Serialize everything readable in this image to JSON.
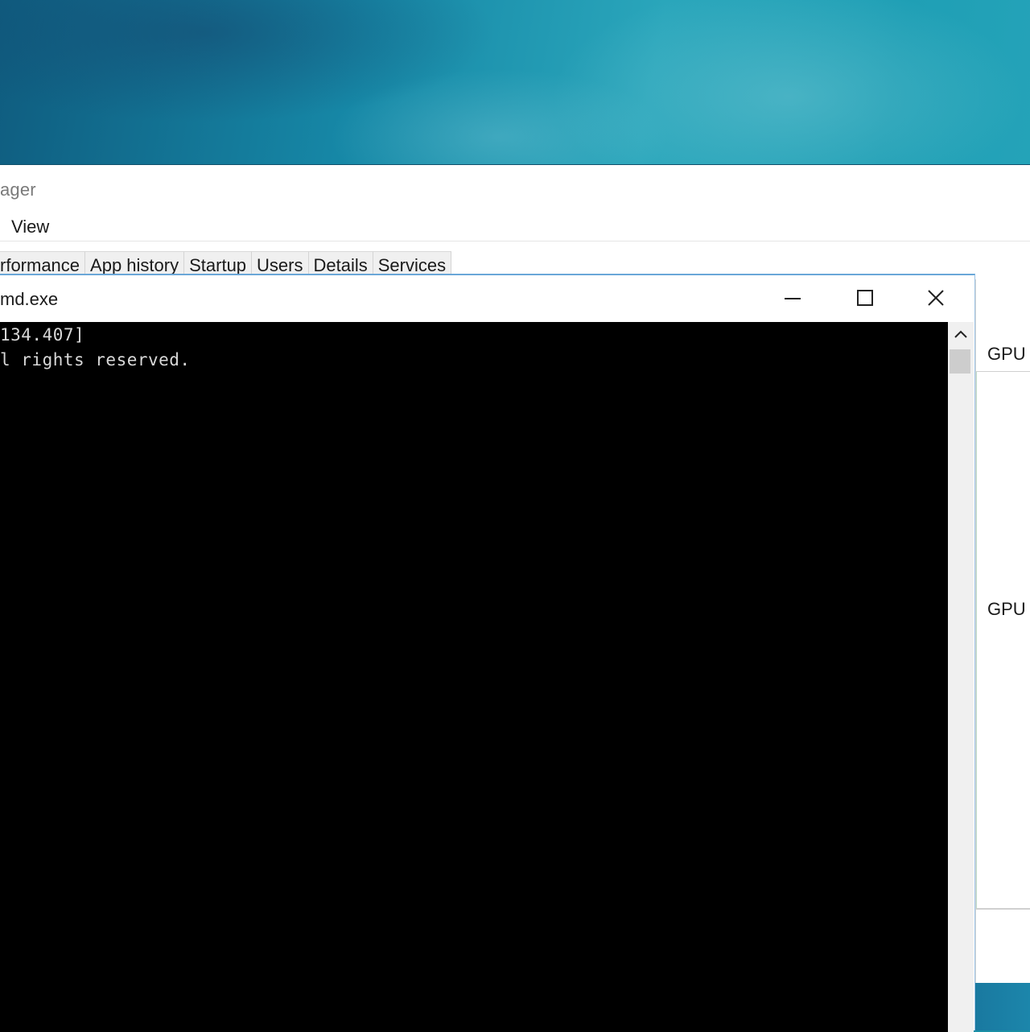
{
  "task_manager": {
    "title": "ager",
    "menu": {
      "view_label": "View"
    },
    "tabs": [
      "rformance",
      "App history",
      "Startup",
      "Users",
      "Details",
      "Services"
    ],
    "panel": {
      "gpu_label_1": "GPU I",
      "gpu_label_2": "GPU ("
    }
  },
  "cmd": {
    "title": "md.exe",
    "lines": [
      "134.407]",
      "l rights reserved."
    ],
    "buttons": {
      "minimize": "minimize",
      "maximize": "maximize",
      "close": "close"
    }
  },
  "icons": {
    "minimize": "minimize-icon",
    "maximize": "maximize-icon",
    "close": "close-icon",
    "scroll_up": "chevron-up-icon"
  },
  "colors": {
    "console_bg": "#000000",
    "console_text": "#d8d8d8",
    "window_border": "#6aa7d8"
  }
}
